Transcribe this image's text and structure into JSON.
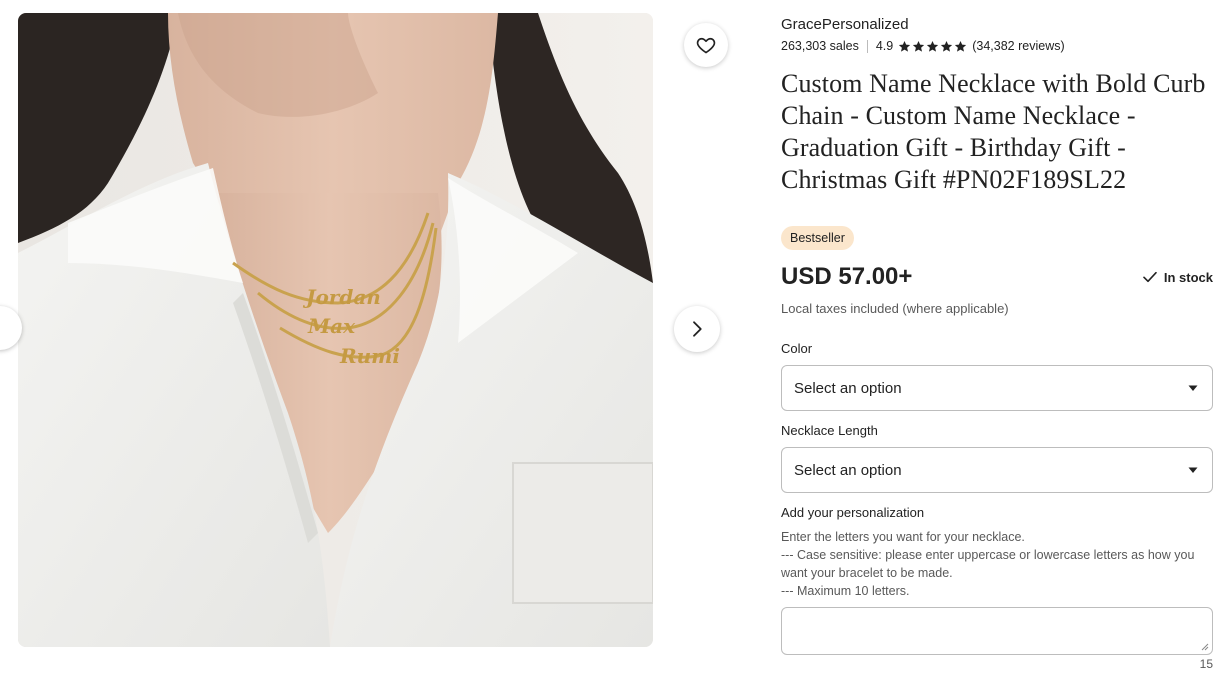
{
  "gallery": {
    "image_alt": "Woman wearing three gold custom name necklaces",
    "necklace_names": [
      "Jordan",
      "Max",
      "Rumi"
    ]
  },
  "icons": {
    "favorite": "heart-icon",
    "next": "chevron-right-icon",
    "star": "star-icon",
    "check": "check-icon",
    "dropdown": "caret-down-icon",
    "resize": "resize-grip-icon"
  },
  "shop": {
    "name": "GracePersonalized",
    "sales": "263,303 sales",
    "rating": "4.9",
    "stars": 5,
    "reviews": "(34,382 reviews)"
  },
  "listing": {
    "title": "Custom Name Necklace with Bold Curb Chain - Custom Name Necklace - Graduation Gift - Birthday Gift - Christmas Gift #PN02F189SL22",
    "badge": "Bestseller",
    "price": "USD 57.00+",
    "stock": "In stock",
    "tax_note": "Local taxes included (where applicable)"
  },
  "options": {
    "color": {
      "label": "Color",
      "value": "Select an option"
    },
    "length": {
      "label": "Necklace Length",
      "value": "Select an option"
    }
  },
  "personalization": {
    "label": "Add your personalization",
    "instructions": "Enter the letters you want for your necklace.\n--- Case sensitive: please enter uppercase or lowercase letters as how you want your bracelet to be made.\n--- Maximum 10 letters.",
    "value": "",
    "char_count": "15"
  },
  "colors": {
    "badge_bg": "#fbe6cc",
    "text": "#222222",
    "muted": "#595959",
    "gold": "#c9a24e"
  }
}
